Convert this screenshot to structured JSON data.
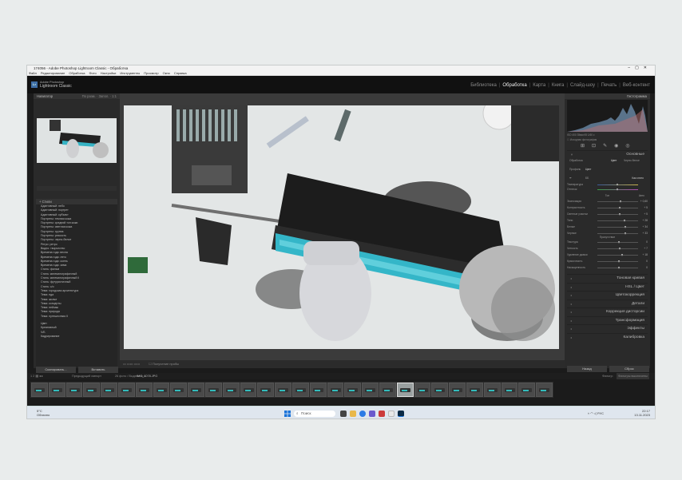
{
  "window": {
    "title": "174056 - Adobe Photoshop Lightroom Classic - Обработка"
  },
  "menubar": [
    "Файл",
    "Редактирование",
    "Обработка",
    "Фото",
    "Настройки",
    "Инструменты",
    "Просмотр",
    "Окно",
    "Справка"
  ],
  "brand": {
    "small": "Adobe Photoshop",
    "name": "Lightroom Classic"
  },
  "modules": [
    {
      "label": "Библиотека",
      "active": false
    },
    {
      "label": "Обработка",
      "active": true
    },
    {
      "label": "Карта",
      "active": false
    },
    {
      "label": "Книга",
      "active": false
    },
    {
      "label": "Слайд-шоу",
      "active": false
    },
    {
      "label": "Печать",
      "active": false
    },
    {
      "label": "Веб-контент",
      "active": false
    }
  ],
  "left_panel": {
    "navigator_title": "Навигатор",
    "fit_label": "По разм.",
    "zoom_1": "Запол.",
    "zoom_2": "1:1",
    "presets_title": "Стили",
    "presets": [
      "Адаптивный: небо",
      "Адаптивный: портрет",
      "Адаптивный: субъект",
      "Портреты: темная кожа",
      "Портреты: средний тон кожи",
      "Портреты: светлая кожа",
      "Портреты: группа",
      "Портреты: резкость",
      "Портреты: черно-белое",
      "Ретро: ретро",
      "Видео: творчество",
      "Времена года: весна",
      "Времена года: лето",
      "Времена года: осень",
      "Времена года: зима",
      "Стиль: фильм",
      "Стиль: кинематографичный",
      "Стиль: кинематографичный II",
      "Стиль: футуристичный",
      "Стиль: c/o",
      "Тема: городская архитектура",
      "Тема: еда",
      "Тема: жилье",
      "Тема: концерты",
      "Тема: пейзаж",
      "Тема: природа",
      "Тема: путешествия II"
    ],
    "presets_extra": [
      "Цвет",
      "Креативный",
      "Ч/Б",
      "Кадрирование"
    ],
    "copy_button": "Скопировать...",
    "paste_button": "Вставить"
  },
  "toolbar": {
    "softproof_label": "Получение пробы"
  },
  "right_panel": {
    "histogram_title": "Гистограмма",
    "histo_info": "ISO 400   35мм   f/8   1/60 с",
    "original_label": "Исходная фотография",
    "basic_title": "Основные",
    "profile_label": "Профиль",
    "profile_value": "Цвет",
    "treatment_label": "Обработка",
    "treatment_color": "Цвет",
    "treatment_bw": "Черно-белое",
    "wb_label": "ББ",
    "wb_value": "Как снято",
    "temp_label": "Температура",
    "tint_label": "Оттенок",
    "tone_label": "Тон",
    "auto_label": "Авто",
    "sliders": [
      {
        "label": "Экспозиция",
        "value": "+ 0,60",
        "pos": 0.55
      },
      {
        "label": "Контрастность",
        "value": "+ 5",
        "pos": 0.52
      },
      {
        "label": "Светлые участки",
        "value": "+ 5",
        "pos": 0.52
      },
      {
        "label": "Тени",
        "value": "+ 28",
        "pos": 0.64
      },
      {
        "label": "Белые",
        "value": "+ 34",
        "pos": 0.67
      },
      {
        "label": "Черные",
        "value": "+ 33",
        "pos": 0.66
      }
    ],
    "presence_label": "Присутствие",
    "presence": [
      {
        "label": "Текстура",
        "value": "0",
        "pos": 0.5
      },
      {
        "label": "Четкость",
        "value": "+ 7",
        "pos": 0.53
      },
      {
        "label": "Удаление дымки",
        "value": "+ 18",
        "pos": 0.59
      },
      {
        "label": "Красочность",
        "value": "0",
        "pos": 0.5
      },
      {
        "label": "Насыщенность",
        "value": "0",
        "pos": 0.5
      }
    ],
    "sections": [
      "Тоновая кривая",
      "HSL / Цвет",
      "Цветокоррекция",
      "Детали",
      "Коррекция дисторсии",
      "Трансформация",
      "Эффекты",
      "Калибровка"
    ],
    "prev_button": "Назад",
    "reset_button": "Сброс"
  },
  "filmstrip_bar": {
    "source": "Предыдущий импорт",
    "count": "26 фото / Выделено 1",
    "filename": "IMG_4078.JPG",
    "filter_label": "Фильтр:",
    "filter_value": "Фильтры выключены"
  },
  "filmstrip": {
    "count": 30,
    "selected": 21
  },
  "taskbar": {
    "temp": "5°C",
    "weather": "Облачно",
    "search": "Поиск",
    "lang": "РУС",
    "time": "22:17",
    "date": "13.11.2023"
  }
}
